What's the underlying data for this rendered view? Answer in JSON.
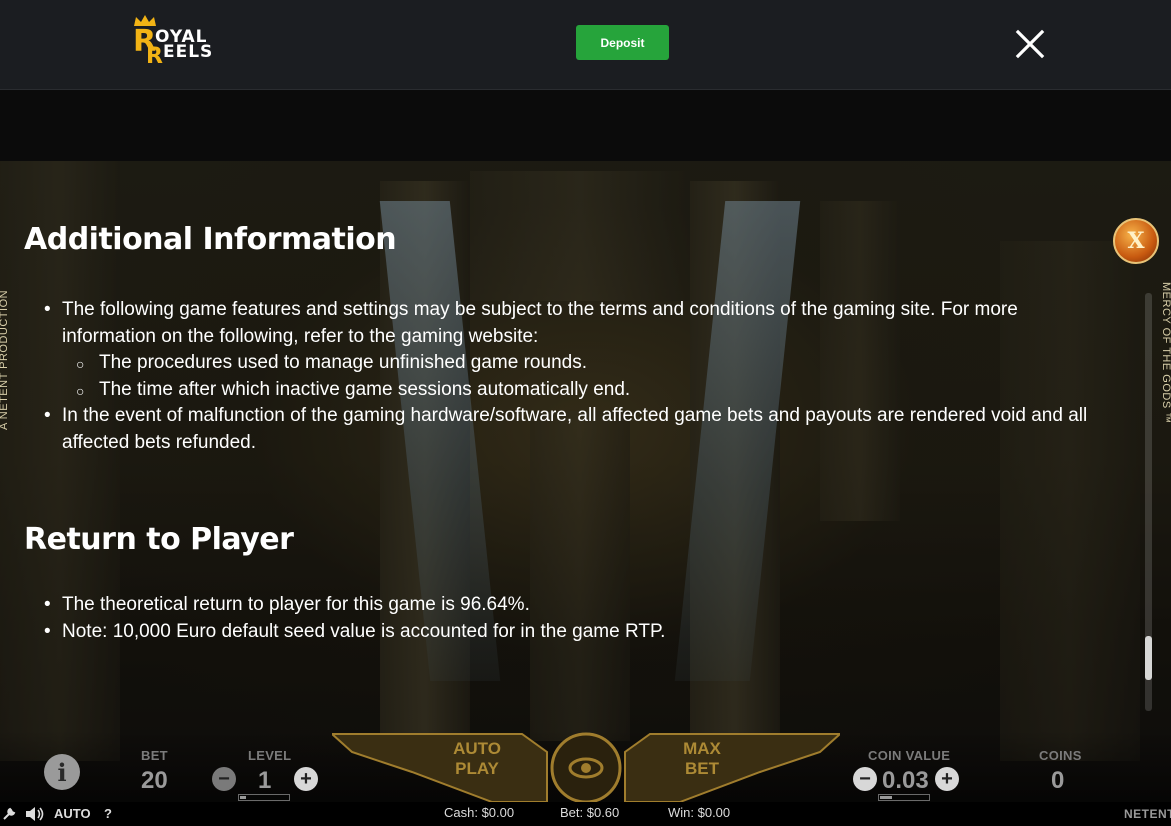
{
  "header": {
    "logo_line1": "OYAL",
    "logo_line2": "EELS",
    "logo_letter1": "R",
    "logo_letter2": "R",
    "deposit_label": "Deposit",
    "close_icon": "close-icon"
  },
  "game": {
    "side_left_text": "A NETENT PRODUCTION",
    "side_right_text": "MERCY OF THE GODS ™",
    "info_close_label": "X"
  },
  "info": {
    "section1_title": "Additional Information",
    "section1_items": [
      "The following game features and settings may be subject to the terms and conditions of the gaming site. For more information on the following, refer to the gaming website:",
      "The procedures used to manage unfinished game rounds.",
      "The time after which inactive game sessions automatically end.",
      "In the event of malfunction of the gaming hardware/software, all affected game bets and payouts are rendered void and all affected bets refunded."
    ],
    "section2_title": "Return to Player",
    "section2_items": [
      "The theoretical return to player for this game is 96.64%.",
      "Note: 10,000 Euro default seed value is accounted for in the game RTP."
    ]
  },
  "controls": {
    "bet_label": "BET",
    "bet_value": "20",
    "level_label": "LEVEL",
    "level_value": "1",
    "autoplay_line1": "AUTO",
    "autoplay_line2": "PLAY",
    "maxbet_line1": "MAX",
    "maxbet_line2": "BET",
    "coin_value_label": "COIN VALUE",
    "coin_value": "0.03",
    "coins_label": "COINS",
    "coins_value": "0",
    "minus": "−",
    "plus": "+",
    "info_symbol": "i"
  },
  "statusbar": {
    "auto_label": "AUTO",
    "help_label": "?",
    "cash": "Cash: $0.00",
    "bet": "Bet: $0.60",
    "win": "Win: $0.00",
    "brand": "NETENT"
  },
  "colors": {
    "deposit_green": "#26a43b",
    "logo_gold": "#f2b315",
    "topbar_bg": "#1b1d21"
  }
}
